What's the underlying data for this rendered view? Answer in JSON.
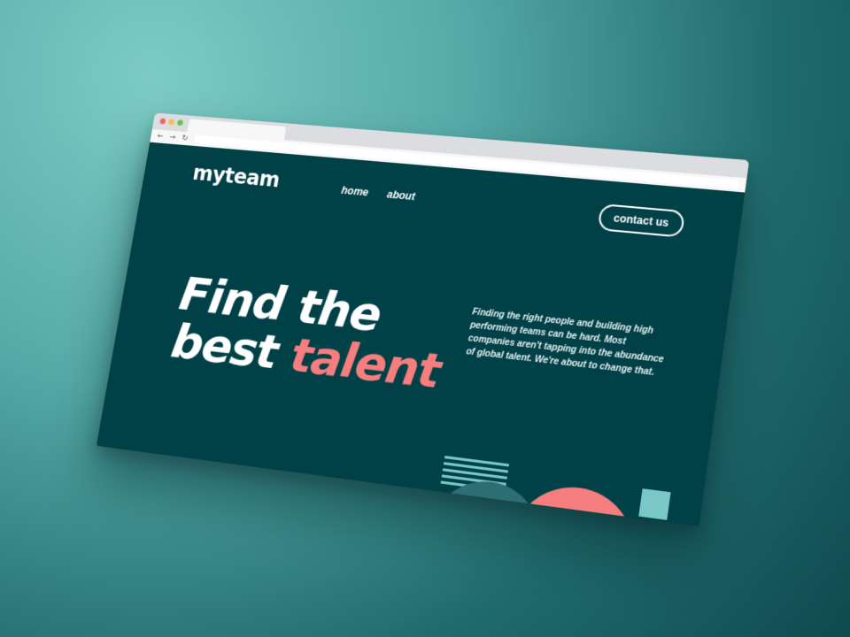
{
  "colors": {
    "background_gradient_light": "#7ccbc5",
    "background_gradient_dark": "#0e4a50",
    "page_bg": "#004047",
    "accent_coral": "#f67e7e",
    "accent_teal": "#79c8c7",
    "text_white": "#ffffff",
    "traffic_red": "#ec6a5e",
    "traffic_yellow": "#f4bf4f",
    "traffic_green": "#61c554"
  },
  "browser": {
    "back_icon": "←",
    "forward_icon": "→",
    "reload_icon": "↻"
  },
  "header": {
    "logo": "myteam",
    "nav": [
      {
        "label": "home"
      },
      {
        "label": "about"
      }
    ],
    "contact_label": "contact us"
  },
  "hero": {
    "line1": "Find the",
    "line2_plain": "best",
    "line2_accent": "talent",
    "intro": "Finding the right people and building high performing teams can be hard. Most companies aren't tapping into the abundance of global talent. We're about to change that."
  },
  "icons": {
    "back": "arrow-left-icon",
    "forward": "arrow-right-icon",
    "reload": "reload-icon"
  }
}
